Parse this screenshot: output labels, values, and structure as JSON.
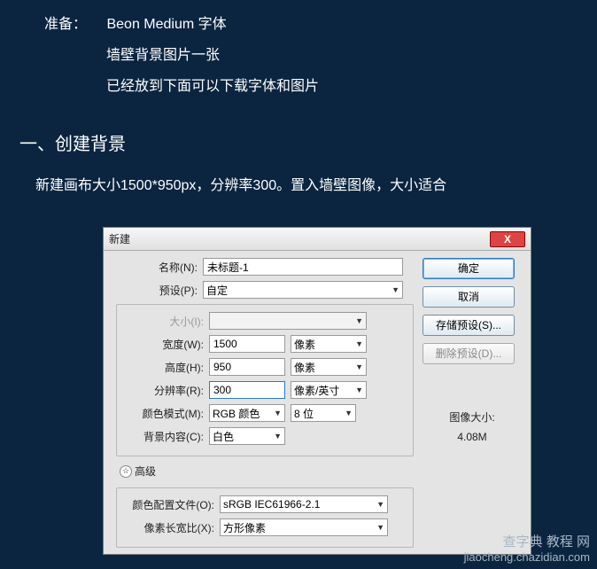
{
  "intro": {
    "prepare_label": "准备：",
    "line1": "Beon Medium 字体",
    "line2": "墙壁背景图片一张",
    "line3": "已经放到下面可以下载字体和图片"
  },
  "section_title": "一、创建背景",
  "description": "新建画布大小1500*950px，分辨率300。置入墙壁图像，大小适合",
  "dialog": {
    "title": "新建",
    "close": "X",
    "name_label": "名称(N):",
    "name_value": "未标题-1",
    "preset_label": "预设(P):",
    "preset_value": "自定",
    "size_label": "大小(I):",
    "width_label": "宽度(W):",
    "width_value": "1500",
    "width_unit": "像素",
    "height_label": "高度(H):",
    "height_value": "950",
    "height_unit": "像素",
    "res_label": "分辨率(R):",
    "res_value": "300",
    "res_unit": "像素/英寸",
    "mode_label": "颜色模式(M):",
    "mode_value": "RGB 颜色",
    "mode_bits": "8 位",
    "bg_label": "背景内容(C):",
    "bg_value": "白色",
    "adv_label": "高级",
    "profile_label": "颜色配置文件(O):",
    "profile_value": "sRGB IEC61966-2.1",
    "aspect_label": "像素长宽比(X):",
    "aspect_value": "方形像素",
    "btn_ok": "确定",
    "btn_cancel": "取消",
    "btn_save_preset": "存储预设(S)...",
    "btn_del_preset": "删除预设(D)...",
    "img_size_label": "图像大小:",
    "img_size_value": "4.08M"
  },
  "watermark": {
    "line1": "查字典 教程 网",
    "line2": "jiaocheng.chazidian.com"
  }
}
